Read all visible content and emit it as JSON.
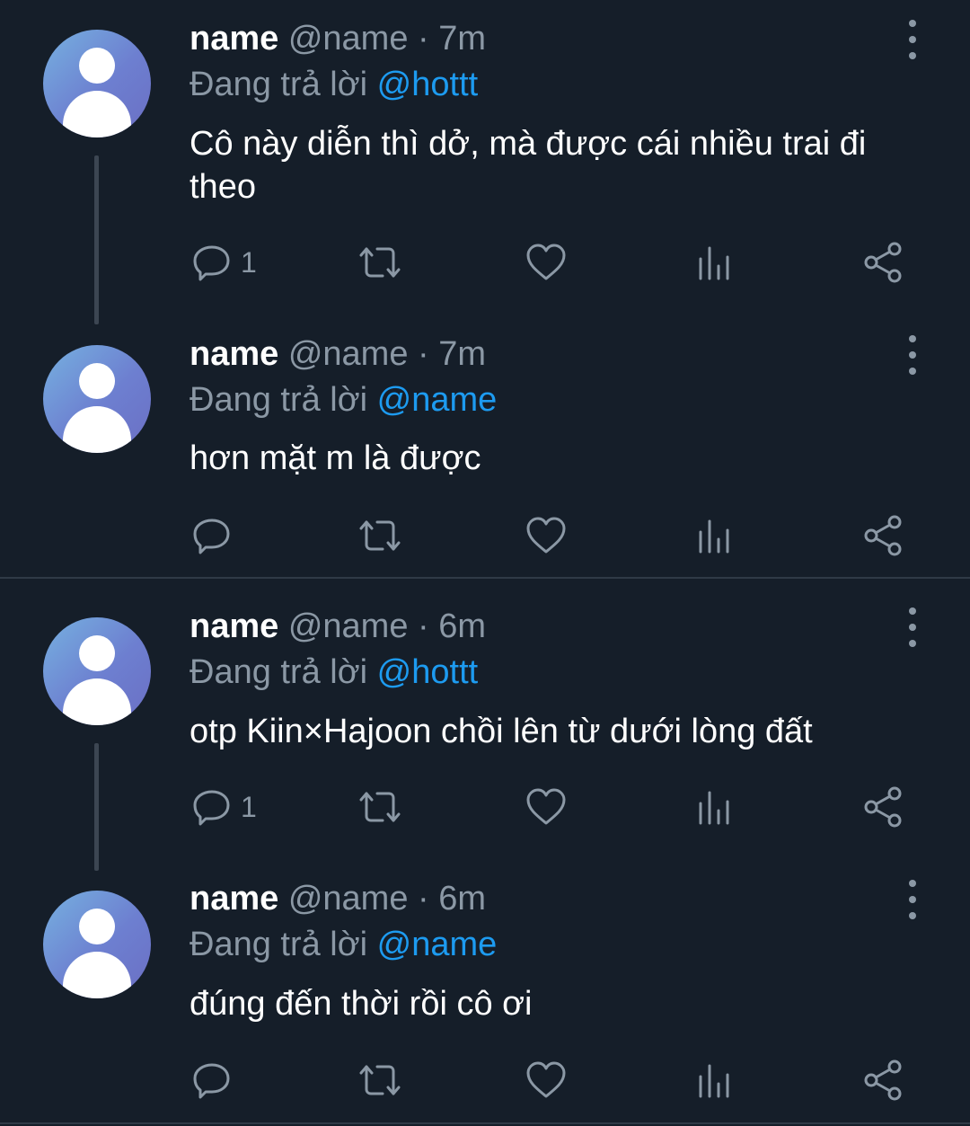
{
  "tweets": [
    {
      "name": "name",
      "handle": "@name",
      "separator": "·",
      "time": "7m",
      "reply_prefix": "Đang trả lời",
      "reply_to": "@hottt",
      "text": "Cô này diễn thì dở, mà được cái nhiều trai đi theo",
      "reply_count": "1"
    },
    {
      "name": "name",
      "handle": "@name",
      "separator": "·",
      "time": "7m",
      "reply_prefix": "Đang trả lời",
      "reply_to": "@name",
      "text": "hơn mặt m là được",
      "reply_count": ""
    },
    {
      "name": "name",
      "handle": "@name",
      "separator": "·",
      "time": "6m",
      "reply_prefix": "Đang trả lời",
      "reply_to": "@hottt",
      "text": "otp Kiin×Hajoon chồi lên từ dưới lòng đất",
      "reply_count": "1"
    },
    {
      "name": "name",
      "handle": "@name",
      "separator": "·",
      "time": "6m",
      "reply_prefix": "Đang trả lời",
      "reply_to": "@name",
      "text": "đúng đến thời rồi cô ơi",
      "reply_count": ""
    }
  ],
  "icons": {
    "reply": "reply-icon",
    "retweet": "retweet-icon",
    "like": "heart-icon",
    "analytics": "analytics-icon",
    "share": "share-icon",
    "more": "more-vertical-icon"
  },
  "colors": {
    "background": "#151e29",
    "text": "#ffffff",
    "secondary": "#8b98a5",
    "mention": "#1d9bf0",
    "avatar_gradient_start": "#76b1e0",
    "avatar_gradient_end": "#6b6fc4"
  }
}
